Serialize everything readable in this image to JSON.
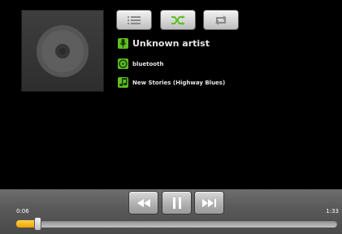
{
  "track": {
    "artist": "Unknown artist",
    "album": "bluetooth",
    "title": "New Stories (Highway Blues)"
  },
  "playback": {
    "elapsed": "0:06",
    "duration": "1:33",
    "progress": 0.065
  },
  "icons": {
    "album_art": "cd-disc-icon",
    "list": "track-list-icon",
    "shuffle": "shuffle-icon",
    "repeat": "repeat-icon",
    "artist": "microphone-icon",
    "album": "disc-icon",
    "song": "music-note-icon",
    "prev": "rewind-icon",
    "pause": "pause-icon",
    "next": "fast-forward-icon"
  },
  "colors": {
    "accent": "#5fbf23",
    "progress": "#f2a400",
    "background": "#000000"
  }
}
